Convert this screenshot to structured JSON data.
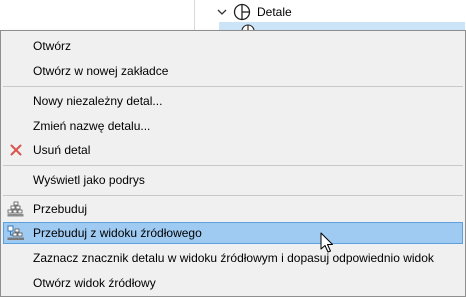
{
  "tree": {
    "node_label": "Detale",
    "icons": {
      "expand": "chevron-down-icon",
      "node": "detail-marker-icon"
    }
  },
  "menu": {
    "items": [
      {
        "label": "Otwórz"
      },
      {
        "label": "Otwórz w nowej zakładce"
      },
      {
        "label": "Nowy niezależny detal..."
      },
      {
        "label": "Zmień nazwę detalu..."
      },
      {
        "label": "Usuń detal",
        "icon": "delete-x-icon"
      },
      {
        "label": "Wyświetl jako podrys"
      },
      {
        "label": "Przebuduj",
        "icon": "rebuild-icon"
      },
      {
        "label": "Przebuduj z widoku źródłowego",
        "icon": "rebuild-from-source-icon",
        "highlighted": true
      },
      {
        "label": "Zaznacz znacznik detalu w widoku źródłowym i dopasuj odpowiednio widok"
      },
      {
        "label": "Otwórz widok źródłowy"
      }
    ]
  },
  "colors": {
    "menu_background": "#f0f0f0",
    "highlight_background": "#9fcaf2",
    "highlight_border": "#5ca0de",
    "delete_icon": "#d9534f",
    "tree_selection": "#cce4f7"
  }
}
